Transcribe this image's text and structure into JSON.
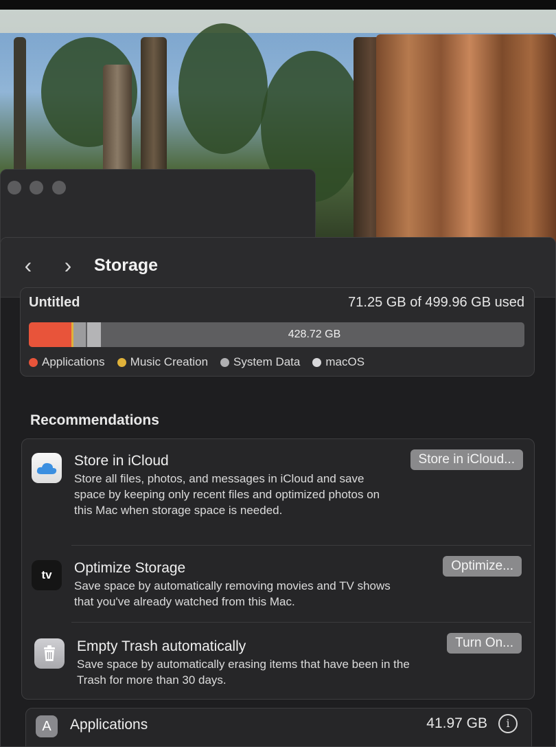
{
  "toolbar": {
    "back_glyph": "‹",
    "forward_glyph": "›",
    "title": "Storage"
  },
  "disk": {
    "name": "Untitled",
    "used_text": "71.25 GB of 499.96 GB used",
    "free_label": "428.72 GB",
    "legend": [
      {
        "label": "Applications",
        "color": "#e8543a"
      },
      {
        "label": "Music Creation",
        "color": "#e0b23a"
      },
      {
        "label": "System Data",
        "color": "#b0b0b2"
      },
      {
        "label": "macOS",
        "color": "#d8d8da"
      }
    ]
  },
  "recommendations": {
    "heading": "Recommendations",
    "items": [
      {
        "icon": "icloud-icon",
        "title": "Store in iCloud",
        "description": "Store all files, photos, and messages in iCloud and save space by keeping only recent files and optimized photos on this Mac when storage space is needed.",
        "button": "Store in iCloud..."
      },
      {
        "icon": "apple-tv-icon",
        "icon_text": "tv",
        "title": "Optimize Storage",
        "description": "Save space by automatically removing movies and TV shows that you've already watched from this Mac.",
        "button": "Optimize..."
      },
      {
        "icon": "trash-icon",
        "title": "Empty Trash automatically",
        "description": "Save space by automatically erasing items that have been in the Trash for more than 30 days.",
        "button": "Turn On..."
      }
    ]
  },
  "categories": [
    {
      "icon": "app-store-icon",
      "label": "Applications",
      "size": "41.97 GB"
    }
  ]
}
